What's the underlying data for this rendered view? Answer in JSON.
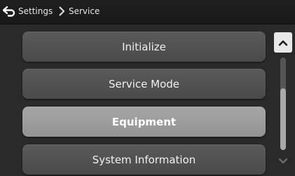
{
  "header": {
    "back_icon": "back-return-arrow-icon",
    "breadcrumb": [
      "Settings",
      "Service"
    ],
    "separator_icon": "chevron-right-icon"
  },
  "menu": {
    "items": [
      {
        "label": "Initialize",
        "selected": false
      },
      {
        "label": "Service Mode",
        "selected": false
      },
      {
        "label": "Equipment",
        "selected": true
      },
      {
        "label": "System Information",
        "selected": false
      }
    ]
  },
  "scrollbar": {
    "up_icon": "chevron-up-icon",
    "down_icon": "chevron-down-icon",
    "thumb_position_fraction": 0.33,
    "thumb_size_fraction": 0.67
  },
  "colors": {
    "background": "#2a2a2a",
    "item": "#505050",
    "item_selected": "#9c9c9c",
    "text": "#f0f0f0"
  }
}
